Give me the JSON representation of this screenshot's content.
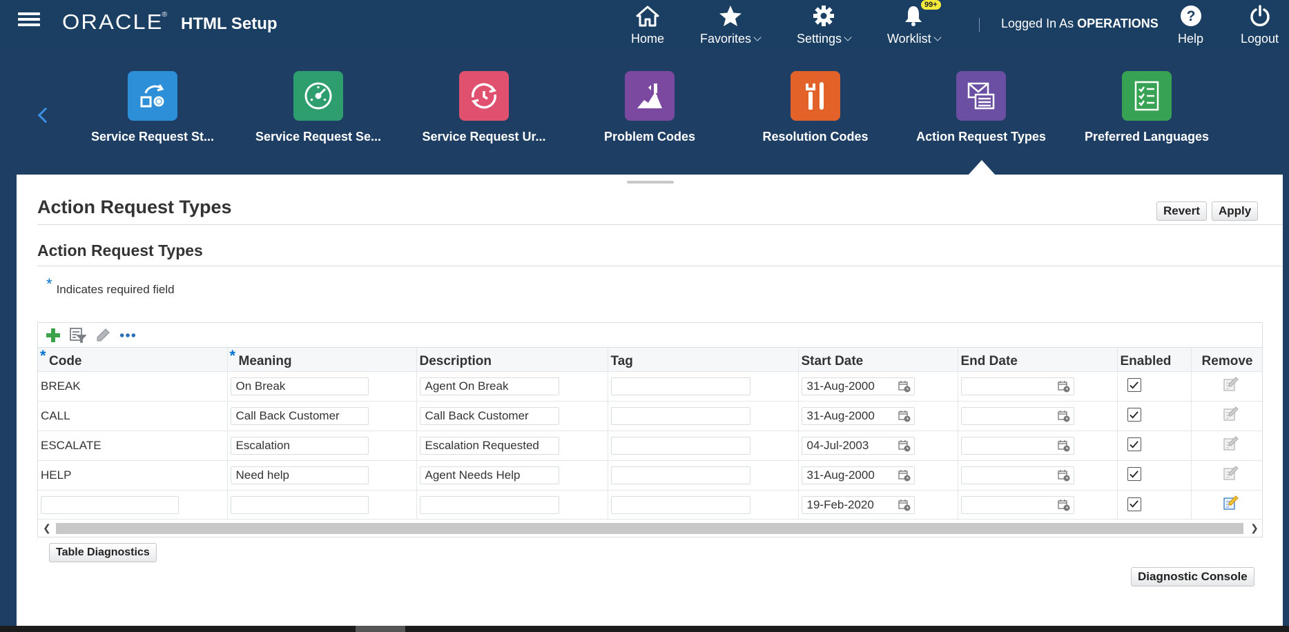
{
  "header": {
    "brand": "ORACLE",
    "brand_mark": "®",
    "app_title": "HTML Setup",
    "nav": [
      {
        "label": "Home",
        "icon": "home-icon"
      },
      {
        "label": "Favorites",
        "icon": "star-icon"
      },
      {
        "label": "Settings",
        "icon": "gear-icon"
      },
      {
        "label": "Worklist",
        "icon": "bell-icon"
      },
      {
        "label": "Help",
        "icon": "help-icon"
      },
      {
        "label": "Logout",
        "icon": "power-icon"
      }
    ],
    "worklist_badge": "99+",
    "logged_in_prefix": "Logged In As",
    "logged_in_user": "OPERATIONS"
  },
  "springboard": {
    "tiles": [
      {
        "label": "Service Request St...",
        "color": "#2d8fd8",
        "icon": "status-flow-icon"
      },
      {
        "label": "Service Request Se...",
        "color": "#2f9e6e",
        "icon": "gauge-icon"
      },
      {
        "label": "Service Request Ur...",
        "color": "#e0506f",
        "icon": "clock-refresh-icon"
      },
      {
        "label": "Problem Codes",
        "color": "#7b4aa0",
        "icon": "problem-chart-icon"
      },
      {
        "label": "Resolution Codes",
        "color": "#e2622a",
        "icon": "tools-icon"
      },
      {
        "label": "Action Request Types",
        "color": "#6a4fa3",
        "icon": "mail-list-icon"
      },
      {
        "label": "Preferred Languages",
        "color": "#37a253",
        "icon": "checklist-icon"
      }
    ]
  },
  "page": {
    "title": "Action Request Types",
    "revert_label": "Revert",
    "apply_label": "Apply",
    "section_title": "Action Request Types",
    "required_star": "*",
    "required_note": "Indicates required field"
  },
  "table": {
    "columns": {
      "code": "Code",
      "meaning": "Meaning",
      "description": "Description",
      "tag": "Tag",
      "start_date": "Start Date",
      "end_date": "End Date",
      "enabled": "Enabled",
      "remove": "Remove"
    },
    "rows": [
      {
        "code": "BREAK",
        "meaning": "On Break",
        "description": "Agent On Break",
        "tag": "",
        "start_date": "31-Aug-2000",
        "end_date": "",
        "enabled": true
      },
      {
        "code": "CALL",
        "meaning": "Call Back Customer",
        "description": "Call Back Customer",
        "tag": "",
        "start_date": "31-Aug-2000",
        "end_date": "",
        "enabled": true
      },
      {
        "code": "ESCALATE",
        "meaning": "Escalation",
        "description": "Escalation Requested",
        "tag": "",
        "start_date": "04-Jul-2003",
        "end_date": "",
        "enabled": true
      },
      {
        "code": "HELP",
        "meaning": "Need help",
        "description": "Agent Needs Help",
        "tag": "",
        "start_date": "31-Aug-2000",
        "end_date": "",
        "enabled": true
      },
      {
        "code": "",
        "meaning": "",
        "description": "",
        "tag": "",
        "start_date": "19-Feb-2020",
        "end_date": "",
        "enabled": true
      }
    ]
  },
  "footer": {
    "table_diagnostics_label": "Table Diagnostics",
    "diagnostic_console_label": "Diagnostic Console"
  }
}
